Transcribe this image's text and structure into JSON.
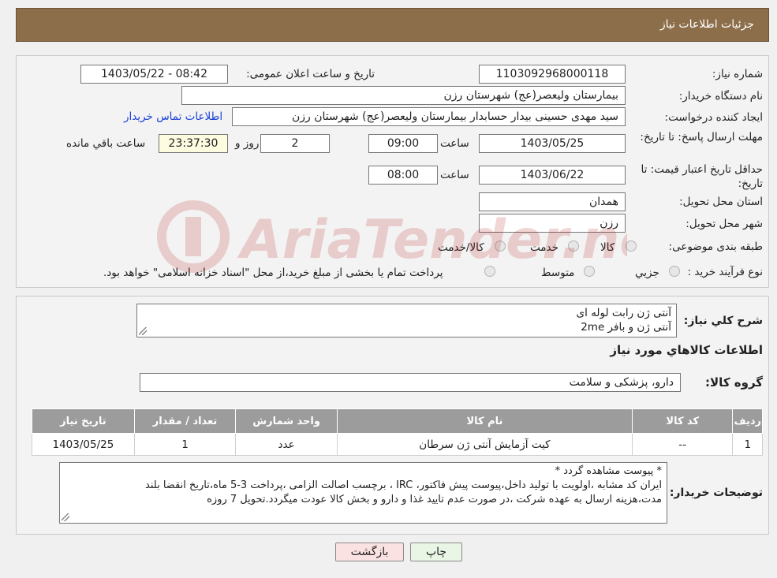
{
  "header": {
    "title": "جزئیات اطلاعات نیاز"
  },
  "info": {
    "need_number_label": "شماره نیاز:",
    "need_number": "1103092968000118",
    "announce_label": "تاریخ و ساعت اعلان عمومی:",
    "announce_value": "1403/05/22 - 08:42",
    "buyer_org_label": "نام دستگاه خریدار:",
    "buyer_org": "بیمارستان ولیعصر(عج) شهرستان رزن",
    "creator_label": "ایجاد کننده درخواست:",
    "creator": "سید مهدی حسینی بیدار حسابدار بیمارستان ولیعصر(عج) شهرستان رزن",
    "contact_link": "اطلاعات تماس خریدار",
    "reply_deadline_label": "مهلت ارسال پاسخ: تا تاریخ:",
    "reply_date": "1403/05/25",
    "time_label": "ساعت",
    "reply_time": "09:00",
    "days": "2",
    "days_label": "روز و",
    "remaining": "23:37:30",
    "remaining_label": "ساعت باقي مانده",
    "validity_label": "حداقل تاریخ اعتبار قیمت: تا تاریخ:",
    "validity_date": "1403/06/22",
    "validity_time": "08:00",
    "province_label": "استان محل تحویل:",
    "province": "همدان",
    "city_label": "شهر محل تحویل:",
    "city": "رزن",
    "category_label": "طبقه بندی موضوعی:",
    "category_options": [
      "کالا",
      "خدمت",
      "کالا/خدمت"
    ],
    "purchase_type_label": "نوع فرآیند خرید :",
    "purchase_type_options": [
      "جزیي",
      "متوسط"
    ],
    "purchase_note": "پرداخت تمام یا بخشی از مبلغ خرید،از محل \"اسناد خزانه اسلامی\" خواهد بود."
  },
  "summary": {
    "general_desc_label": "شرح کلي نياز:",
    "general_desc_line1": "آنتی ژن رابت لوله ای",
    "general_desc_line2": "آنتی ژن و بافر 2me",
    "goods_info_title": "اطلاعات کالاهاي مورد نياز",
    "goods_group_label": "گروه کالا:",
    "goods_group": "دارو، پزشکی و سلامت"
  },
  "table": {
    "headers": [
      "رديف",
      "کد کالا",
      "نام کالا",
      "واحد شمارش",
      "تعداد / مقدار",
      "تاریخ نیاز"
    ],
    "rows": [
      {
        "row": "1",
        "code": "--",
        "name": "کیت آزمایش آنتی ژن سرطان",
        "unit": "عدد",
        "qty": "1",
        "date": "1403/05/25"
      }
    ]
  },
  "buyer_notes": {
    "label": "توضیحات خریدار:",
    "line1": "* پیوست مشاهده گردد *",
    "line2": "ایران کد مشابه ،اولویت با تولید داخل،پیوست پیش فاکتور، IRC ، برچسب اصالت الزامی ،پرداخت 3-5 ماه،تاریخ انقضا بلند",
    "line3": "مدت،هزینه ارسال به عهده شرکت ،در صورت عدم تایید غذا و دارو و بخش کالا عودت میگردد.تحویل 7 روزه"
  },
  "buttons": {
    "print": "چاپ",
    "back": "بازگشت"
  },
  "watermark": {
    "text": "AriaTender.neT"
  }
}
